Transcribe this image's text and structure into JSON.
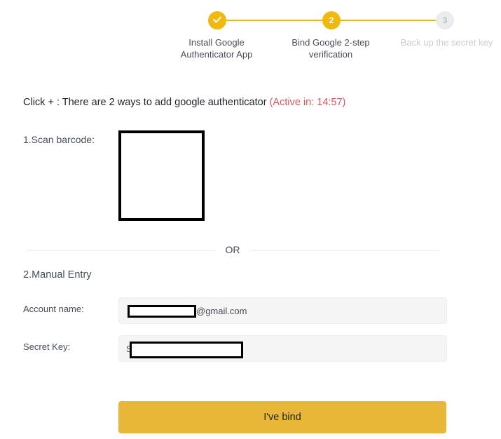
{
  "stepper": {
    "steps": [
      {
        "number": "1",
        "label_line1": "Install Google",
        "label_line2": "Authenticator App",
        "state": "done",
        "icon": "checkmark-icon"
      },
      {
        "number": "2",
        "label_line1": "Bind Google 2-step",
        "label_line2": "verification",
        "state": "active"
      },
      {
        "number": "3",
        "label_line1": "Back up the secret key",
        "label_line2": "",
        "state": "pending"
      }
    ],
    "accent_color": "#f0b90b"
  },
  "main": {
    "heading": "Click + : There are 2 ways to add google authenticator",
    "timer": "(Active in: 14:57)",
    "scan_label": "1.Scan barcode:",
    "or_text": "OR",
    "manual_label": "2.Manual Entry",
    "account_label": "Account name:",
    "account_prefix": "",
    "account_suffix": "@gmail.com",
    "secret_label": "Secret Key:",
    "secret_prefix": "S"
  },
  "actions": {
    "bind_button": "I've bind",
    "button_color": "#e9b738"
  }
}
